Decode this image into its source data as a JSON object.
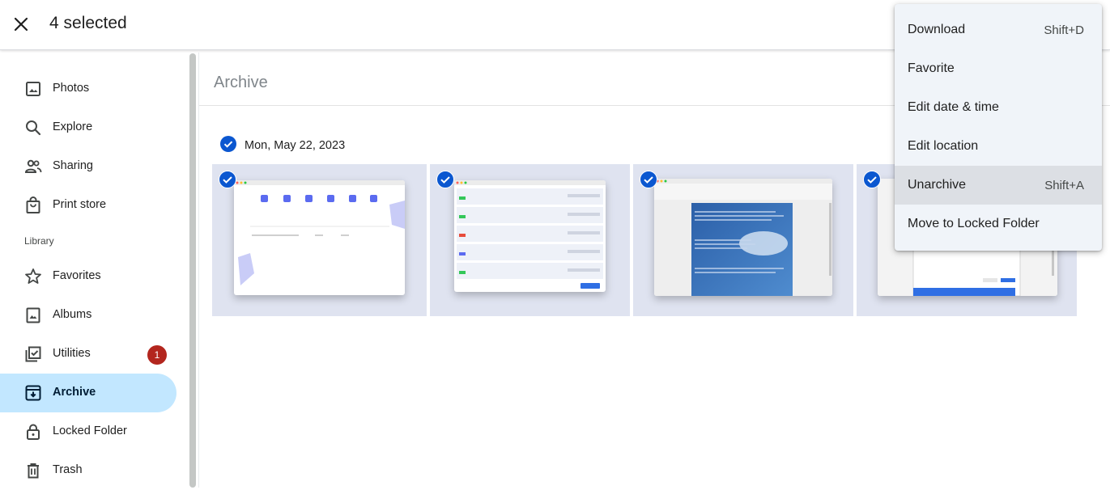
{
  "header": {
    "close_icon": "close-icon",
    "selected_text": "4 selected"
  },
  "sidebar": {
    "items": [
      {
        "label": "Photos",
        "icon": "photo-icon"
      },
      {
        "label": "Explore",
        "icon": "search-icon"
      },
      {
        "label": "Sharing",
        "icon": "people-icon"
      },
      {
        "label": "Print store",
        "icon": "shopping-bag-icon"
      },
      {
        "label": "Favorites",
        "icon": "star-icon"
      },
      {
        "label": "Albums",
        "icon": "album-icon"
      },
      {
        "label": "Utilities",
        "icon": "checklist-icon",
        "badge": "1"
      },
      {
        "label": "Archive",
        "icon": "archive-icon",
        "active": true
      },
      {
        "label": "Locked Folder",
        "icon": "lock-icon"
      },
      {
        "label": "Trash",
        "icon": "trash-icon"
      }
    ],
    "library_label": "Library"
  },
  "main": {
    "title": "Archive",
    "date_group": "Mon, May 22, 2023",
    "photos": [
      {
        "selected": true,
        "name": "screenshot-1"
      },
      {
        "selected": true,
        "name": "screenshot-2"
      },
      {
        "selected": true,
        "name": "screenshot-3"
      },
      {
        "selected": true,
        "name": "screenshot-4"
      }
    ]
  },
  "menu": {
    "items": [
      {
        "label": "Download",
        "shortcut": "Shift+D"
      },
      {
        "label": "Favorite",
        "shortcut": ""
      },
      {
        "label": "Edit date & time",
        "shortcut": ""
      },
      {
        "label": "Edit location",
        "shortcut": ""
      },
      {
        "label": "Unarchive",
        "shortcut": "Shift+A",
        "highlighted": true
      },
      {
        "label": "Move to Locked Folder",
        "shortcut": ""
      }
    ]
  },
  "colors": {
    "accent": "#0b57d0",
    "active_bg": "#c2e7ff",
    "badge": "#b3261e",
    "menu_bg": "#f0f4f9"
  }
}
